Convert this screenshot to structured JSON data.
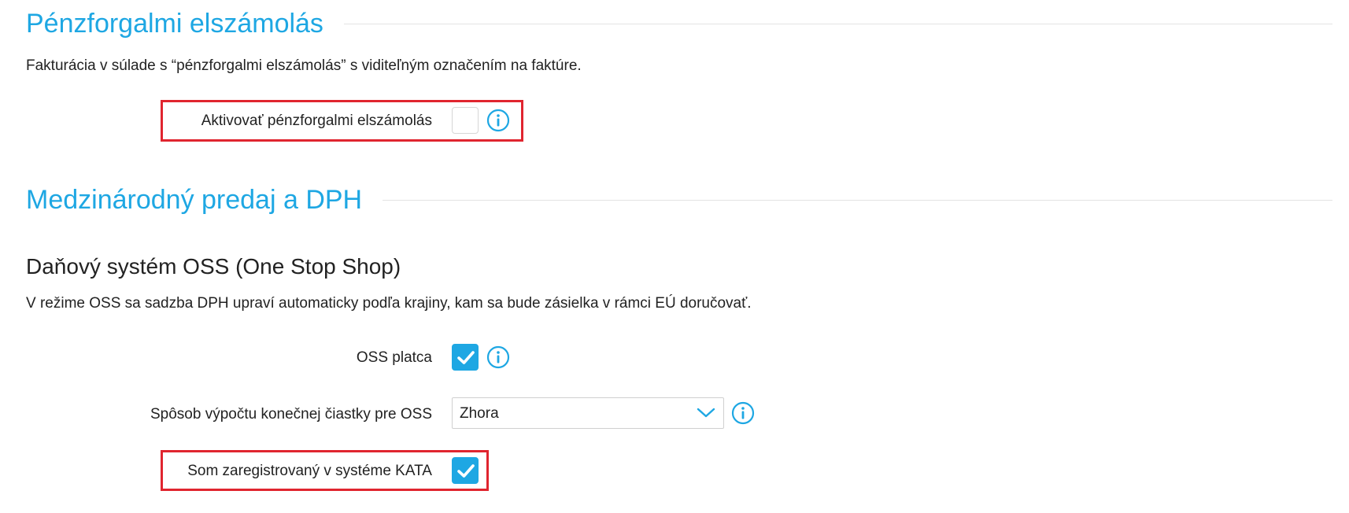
{
  "cashflow_section": {
    "title": "Pénzforgalmi elszámolás",
    "description": "Fakturácia v súlade s “pénzforgalmi elszámolás” s viditeľným označením na faktúre.",
    "activate_label": "Aktivovať pénzforgalmi elszámolás",
    "activate_checked": false
  },
  "intl_section": {
    "title": "Medzinárodný predaj a DPH",
    "oss_subtitle": "Daňový systém OSS (One Stop Shop)",
    "oss_description": "V režime OSS sa sadzba DPH upraví automaticky podľa krajiny, kam sa bude zásielka v rámci EÚ doručovať.",
    "oss_payer_label": "OSS platca",
    "oss_payer_checked": true,
    "calc_method_label": "Spôsob výpočtu konečnej čiastky pre OSS",
    "calc_method_value": "Zhora",
    "kata_label": "Som zaregistrovaný v systéme KATA",
    "kata_checked": true
  },
  "icons": {
    "info": "info-circle-icon",
    "check": "checkmark-icon",
    "dropdown": "chevron-down-icon"
  },
  "colors": {
    "accent": "#1ea7e3",
    "highlight": "#e0252f",
    "divider": "#e3e3e3"
  }
}
